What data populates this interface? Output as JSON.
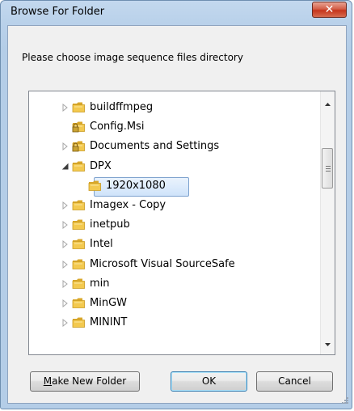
{
  "window": {
    "title": "Browse For Folder",
    "close_label": "✕"
  },
  "instruction": "Please choose image sequence files directory",
  "tree": {
    "items": [
      {
        "label": "buildffmpeg",
        "expander": "collapsed",
        "locked": false,
        "selected": false
      },
      {
        "label": "Config.Msi",
        "expander": "none",
        "locked": true,
        "selected": false
      },
      {
        "label": "Documents and Settings",
        "expander": "collapsed",
        "locked": true,
        "selected": false
      },
      {
        "label": "DPX",
        "expander": "expanded",
        "locked": false,
        "selected": false
      },
      {
        "label": "1920x1080",
        "expander": "none",
        "locked": false,
        "selected": true
      },
      {
        "label": "Imagex - Copy",
        "expander": "collapsed",
        "locked": false,
        "selected": false
      },
      {
        "label": "inetpub",
        "expander": "collapsed",
        "locked": false,
        "selected": false
      },
      {
        "label": "Intel",
        "expander": "collapsed",
        "locked": false,
        "selected": false
      },
      {
        "label": "Microsoft Visual SourceSafe",
        "expander": "collapsed",
        "locked": false,
        "selected": false
      },
      {
        "label": "min",
        "expander": "collapsed",
        "locked": false,
        "selected": false
      },
      {
        "label": "MinGW",
        "expander": "collapsed",
        "locked": false,
        "selected": false
      },
      {
        "label": "MININT",
        "expander": "collapsed",
        "locked": false,
        "selected": false
      }
    ]
  },
  "buttons": {
    "make_new_folder_prefix": "M",
    "make_new_folder_rest": "ake New Folder",
    "ok": "OK",
    "cancel": "Cancel"
  },
  "colors": {
    "folder_yellow": "#f3c94f",
    "folder_dark": "#d9a72a",
    "lock_gold": "#c9a233",
    "selection": "#cfe3fa"
  }
}
